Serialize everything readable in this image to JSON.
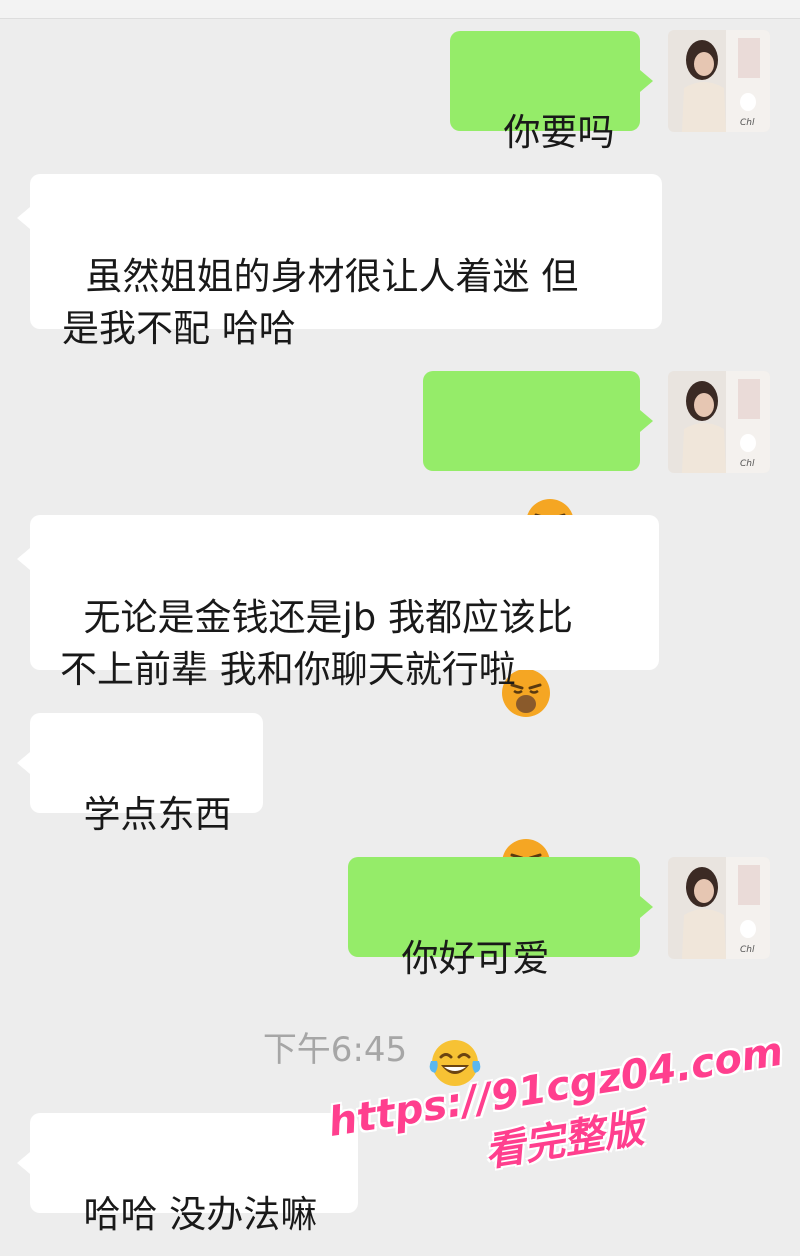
{
  "messages": [
    {
      "direction": "outgoing",
      "text": "你要吗"
    },
    {
      "direction": "incoming",
      "text": "虽然姐姐的身材很让人着迷 但\n是我不配 哈哈"
    },
    {
      "direction": "outgoing",
      "emojis": [
        "grimace-emoji",
        "grimace-emoji",
        "grimace-emoji"
      ]
    },
    {
      "direction": "incoming",
      "text": "无论是金钱还是jb 我都应该比\n不上前辈 我和你聊天就行啦"
    },
    {
      "direction": "incoming",
      "text": "学点东西"
    },
    {
      "direction": "outgoing",
      "text": "你好可爱",
      "emoji": "tears-of-joy-emoji"
    },
    {
      "direction": "incoming",
      "text": "哈哈 没办法嘛"
    }
  ],
  "timestamp": "下午6:45",
  "watermark": {
    "url": "https://91cgz04.com",
    "text": "看完整版"
  },
  "colors": {
    "background": "#ededed",
    "outgoing_bubble": "#95ec69",
    "incoming_bubble": "#ffffff",
    "timestamp": "#a6a6a6",
    "watermark": "#ff3f8e"
  }
}
